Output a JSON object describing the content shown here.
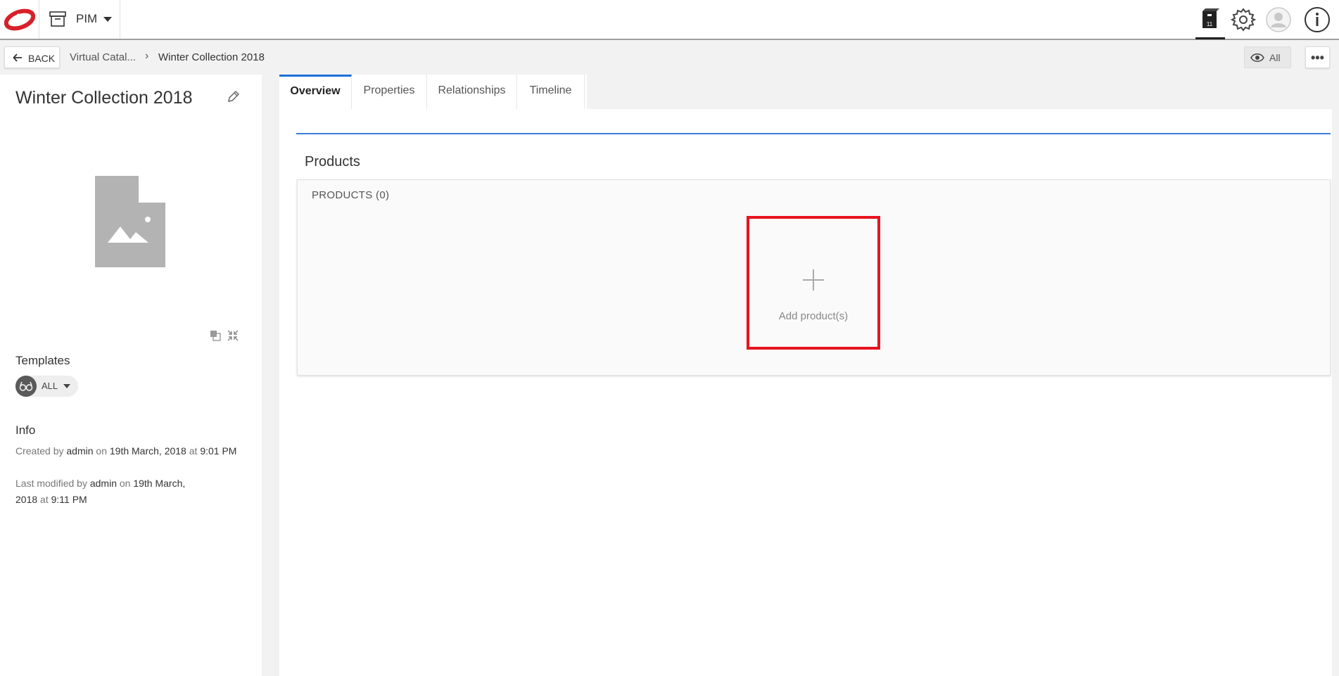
{
  "header": {
    "app_label": "PIM",
    "icons": [
      "catalog-icon",
      "settings-icon",
      "user-icon",
      "info-icon"
    ],
    "cart_badge": "11"
  },
  "breadcrumb": {
    "back_label": "BACK",
    "items": [
      "Virtual Catal...",
      "Winter Collection 2018"
    ],
    "separator": "›",
    "view_label": "All",
    "more_label": "•••"
  },
  "details": {
    "title": "Winter Collection 2018",
    "templates_heading": "Templates",
    "template_value": "ALL",
    "info_heading": "Info",
    "created": {
      "prefix": "Created by",
      "user": "admin",
      "on": "on",
      "date": "19th March, 2018",
      "at": "at",
      "time": "9:01 PM"
    },
    "modified": {
      "prefix": "Last modified by",
      "user": "admin",
      "on": "on",
      "date": "19th March, 2018",
      "at": "at",
      "time": "9:11 PM"
    }
  },
  "tabs": [
    {
      "label": "Overview",
      "active": true
    },
    {
      "label": "Properties",
      "active": false
    },
    {
      "label": "Relationships",
      "active": false
    },
    {
      "label": "Timeline",
      "active": false
    }
  ],
  "products": {
    "heading": "Products",
    "count_label": "PRODUCTS (0)",
    "add_label": "Add product(s)"
  },
  "colors": {
    "brand_red": "#d8202a",
    "accent_blue": "#1e6fd9",
    "highlight_red": "#e8141e"
  }
}
